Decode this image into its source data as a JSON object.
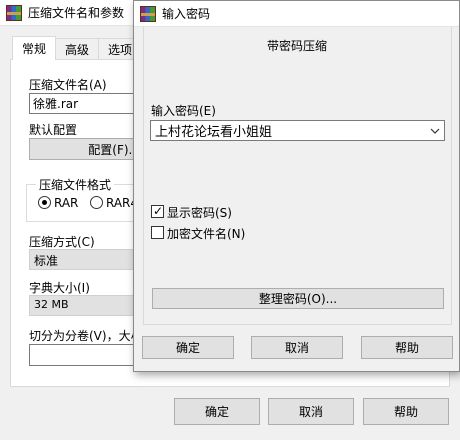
{
  "background_window": {
    "title": "压缩文件名和参数",
    "tabs": [
      "常规",
      "高级",
      "选项"
    ],
    "archive_name_label": "压缩文件名(A)",
    "archive_name_value": "徐雅.rar",
    "default_profile_label": "默认配置",
    "profile_button": "配置(F)...",
    "format_group_title": "压缩文件格式",
    "format_options": [
      "RAR",
      "RAR4"
    ],
    "method_label": "压缩方式(C)",
    "method_value": "标准",
    "dict_label": "字典大小(I)",
    "dict_value": "32 MB",
    "split_label": "切分为分卷(V)，大小",
    "buttons": {
      "ok": "确定",
      "cancel": "取消",
      "help": "帮助"
    }
  },
  "password_dialog": {
    "title": "输入密码",
    "heading": "带密码压缩",
    "password_label": "输入密码(E)",
    "password_value": "上村花论坛看小姐姐",
    "show_password_label": "显示密码(S)",
    "show_password_checked": true,
    "encrypt_names_label": "加密文件名(N)",
    "encrypt_names_checked": false,
    "organize_button": "整理密码(O)...",
    "buttons": {
      "ok": "确定",
      "cancel": "取消",
      "help": "帮助"
    }
  },
  "icons": [
    "winrar-icon",
    "chevron-down-icon",
    "checkmark-icon"
  ]
}
